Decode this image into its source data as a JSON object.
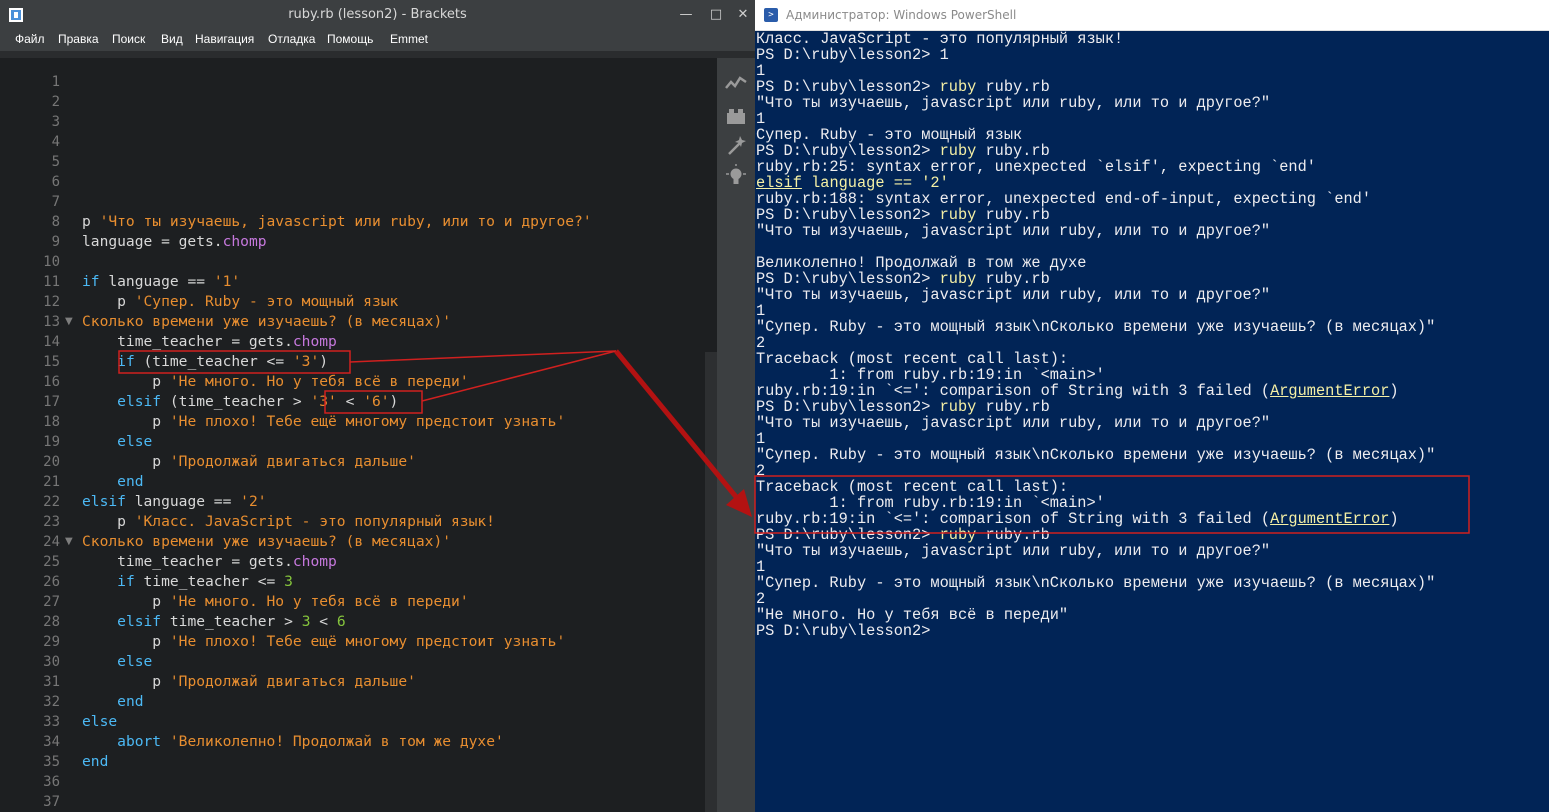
{
  "brackets": {
    "title": "ruby.rb (lesson2) - Brackets",
    "window_controls": {
      "minimize": "—",
      "maximize": "□",
      "close": "✕"
    },
    "menu": [
      "Файл",
      "Правка",
      "Поиск",
      "Вид",
      "Навигация",
      "Отладка",
      "Помощь",
      "Emmet"
    ],
    "line_numbers": [
      "1",
      "2",
      "3",
      "4",
      "5",
      "6",
      "7",
      "8",
      "9",
      "10",
      "11",
      "12",
      "13",
      "14",
      "15",
      "16",
      "17",
      "18",
      "19",
      "20",
      "21",
      "22",
      "23",
      "24",
      "25",
      "26",
      "27",
      "28",
      "29",
      "30",
      "31",
      "32",
      "33",
      "34",
      "35",
      "36",
      "37"
    ],
    "folded_lines": [
      "13",
      "24"
    ],
    "code_lines": [
      "",
      "",
      "",
      "",
      "",
      "",
      "",
      "p 'Что ты изучаешь, javascript или ruby, или то и другое?'",
      "language = gets.chomp",
      "",
      "if language == '1'",
      "    p 'Супер. Ruby - это мощный язык",
      "Сколько времени уже изучаешь? (в месяцах)'",
      "    time_teacher = gets.chomp",
      "    if (time_teacher <= '3')",
      "        p 'Не много. Но у тебя всё в переди'",
      "    elsif (time_teacher > '3' < '6')",
      "        p 'Не плохо! Тебе ещё многому предстоит узнать'",
      "    else",
      "        p 'Продолжай двигаться дальше'",
      "    end",
      "elsif language == '2'",
      "    p 'Класс. JavaScript - это популярный язык!",
      "Сколько времени уже изучаешь? (в месяцах)'",
      "    time_teacher = gets.chomp",
      "    if time_teacher <= 3",
      "        p 'Не много. Но у тебя всё в переди'",
      "    elsif time_teacher > 3 < 6",
      "        p 'Не плохо! Тебе ещё многому предстоит узнать'",
      "    else",
      "        p 'Продолжай двигаться дальше'",
      "    end",
      "else",
      "    abort 'Великолепно! Продолжай в том же духе'",
      "end",
      "",
      ""
    ],
    "toolbar_icons": [
      "live-preview-icon",
      "extension-manager-icon",
      "beautify-icon",
      "lightbulb-icon"
    ]
  },
  "powershell": {
    "title": "Администратор: Windows PowerShell",
    "lines": [
      "Класс. JavaScript - это популярный язык!",
      "PS D:\\ruby\\lesson2> 1",
      "1",
      "PS D:\\ruby\\lesson2> ruby ruby.rb",
      "\"Что ты изучаешь, javascript или ruby, или то и другое?\"",
      "1",
      "Супер. Ruby - это мощный язык",
      "PS D:\\ruby\\lesson2> ruby ruby.rb",
      "ruby.rb:25: syntax error, unexpected `elsif', expecting `end'",
      "elsif language == '2'",
      "ruby.rb:188: syntax error, unexpected end-of-input, expecting `end'",
      "PS D:\\ruby\\lesson2> ruby ruby.rb",
      "\"Что ты изучаешь, javascript или ruby, или то и другое?\"",
      "",
      "Великолепно! Продолжай в том же духе",
      "PS D:\\ruby\\lesson2> ruby ruby.rb",
      "\"Что ты изучаешь, javascript или ruby, или то и другое?\"",
      "1",
      "\"Супер. Ruby - это мощный язык\\nСколько времени уже изучаешь? (в месяцах)\"",
      "2",
      "Traceback (most recent call last):",
      "        1: from ruby.rb:19:in `<main>'",
      "ruby.rb:19:in `<=': comparison of String with 3 failed (ArgumentError)",
      "PS D:\\ruby\\lesson2> ruby ruby.rb",
      "\"Что ты изучаешь, javascript или ruby, или то и другое?\"",
      "1",
      "\"Супер. Ruby - это мощный язык\\nСколько времени уже изучаешь? (в месяцах)\"",
      "2",
      "Traceback (most recent call last):",
      "        1: from ruby.rb:19:in `<main>'",
      "ruby.rb:19:in `<=': comparison of String with 3 failed (ArgumentError)",
      "PS D:\\ruby\\lesson2> ruby ruby.rb",
      "\"Что ты изучаешь, javascript или ruby, или то и другое?\"",
      "1",
      "\"Супер. Ruby - это мощный язык\\nСколько времени уже изучаешь? (в месяцах)\"",
      "2",
      "\"Не много. Но у тебя всё в переди\"",
      "PS D:\\ruby\\lesson2>"
    ]
  },
  "colors": {
    "editor_bg": "#1d1f21",
    "keyword": "#4cb9f5",
    "string": "#e88e30",
    "number": "#85c43c",
    "method": "#c678dd",
    "powershell_bg": "#012456",
    "powershell_text": "#eeedf0",
    "annotation_red": "#d0201f",
    "arrow_red": "#b31212"
  }
}
